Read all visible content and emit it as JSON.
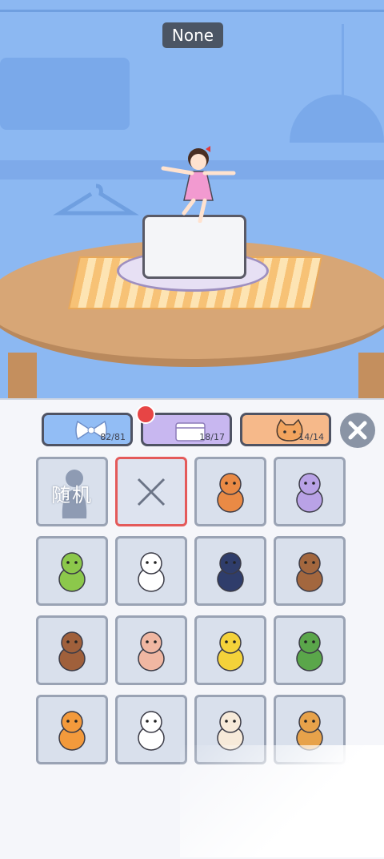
{
  "top_label": "None",
  "tabs": [
    {
      "id": "bow",
      "count": "82/81",
      "color": "#92bdf5",
      "icon": "bow-icon"
    },
    {
      "id": "box",
      "count": "18/17",
      "color": "#c8b7f0",
      "icon": "box-icon"
    },
    {
      "id": "animal",
      "count": "14/14",
      "color": "#f6b98a",
      "icon": "cat-face-icon"
    }
  ],
  "random_label": "随机",
  "grid": [
    {
      "name": "random"
    },
    {
      "name": "none"
    },
    {
      "name": "shiba-dog"
    },
    {
      "name": "purple-cat"
    },
    {
      "name": "green-parrot"
    },
    {
      "name": "rabbit"
    },
    {
      "name": "penguin"
    },
    {
      "name": "squirrel"
    },
    {
      "name": "brown-bear"
    },
    {
      "name": "pig"
    },
    {
      "name": "yellow-snake"
    },
    {
      "name": "frog-on-turtle"
    },
    {
      "name": "fox"
    },
    {
      "name": "panda"
    },
    {
      "name": "sheep"
    },
    {
      "name": "lion"
    }
  ]
}
